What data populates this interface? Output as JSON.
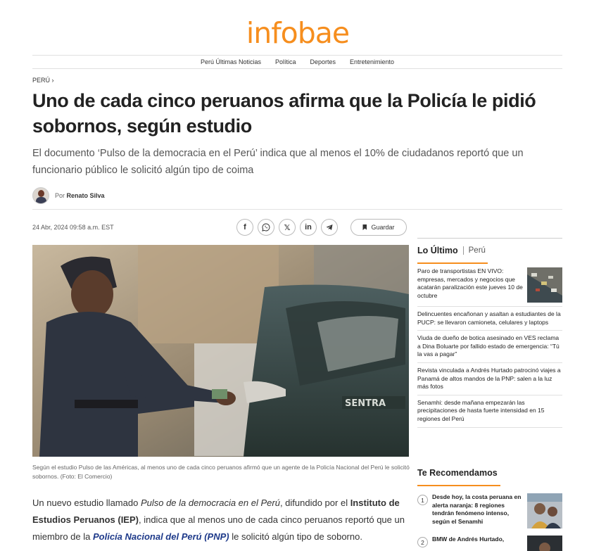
{
  "brand": {
    "logo": "infobae",
    "accent": "#f68e1e"
  },
  "nav": {
    "items": [
      "Perú Últimas Noticias",
      "Política",
      "Deportes",
      "Entretenimiento"
    ]
  },
  "article": {
    "section": "PERÚ ›",
    "headline": "Uno de cada cinco peruanos afirma que la Policía le pidió sobornos, según estudio",
    "deck": "El documento ‘Pulso de la democracia en el Perú’ indica que al menos el 10% de ciudadanos reportó que un funcionario público le solicitó algún tipo de coima",
    "author_prefix": "Por",
    "author": "Renato Silva",
    "date": "24 Abr, 2024 09:58 a.m. EST",
    "save_label": "Guardar",
    "caption": "Según el estudio Pulso de las Américas, al menos uno de cada cinco peruanos afirmó que un agente de la Policía Nacional del Perú le solicitó sobornos. (Foto: El Comercio)",
    "body": {
      "t1": "Un nuevo estudio llamado ",
      "t2": "Pulso de la democracia en el Perú",
      "t3": ", difundido por el ",
      "t4": "Instituto de Estudios Peruanos (IEP)",
      "t5": ", indica que al menos uno de cada cinco peruanos reportó que un miembro de la ",
      "t6": "Policía Nacional del Perú (PNP)",
      "t7": " le solicitó algún tipo de soborno."
    },
    "photo_text": "SENTRA"
  },
  "share": {
    "facebook": "f",
    "x": "𝕏",
    "linkedin": "in",
    "icons": [
      "facebook-icon",
      "whatsapp-icon",
      "x-icon",
      "linkedin-icon",
      "telegram-icon"
    ]
  },
  "sidebar": {
    "title": "Lo Último",
    "subtitle": "Perú",
    "items": [
      {
        "text": "Paro de transportistas EN VIVO: empresas, mercados y negocios que acatarán paralización este jueves 10 de octubre"
      },
      {
        "text": "Delincuentes encañonan y asaltan a estudiantes de la PUCP: se llevaron camioneta, celulares y laptops"
      },
      {
        "text": "Viuda de dueño de botica asesinado en VES reclama a Dina Boluarte por fallido estado de emergencia: “Tú la vas a pagar”"
      },
      {
        "text": "Revista vinculada a Andrés Hurtado patrocinó viajes a Panamá de altos mandos de la PNP: salen a la luz más fotos"
      },
      {
        "text": "Senamhi: desde mañana empezarán las precipitaciones de hasta fuerte intensidad en 15 regiones del Perú"
      }
    ]
  },
  "recommended": {
    "title": "Te Recomendamos",
    "items": [
      {
        "num": "1",
        "text": "Desde hoy, la costa peruana en alerta naranja: 8 regiones tendrán fenómeno intenso, según el Senamhi"
      },
      {
        "num": "2",
        "text": "BMW de Andrés Hurtado, "
      }
    ]
  }
}
